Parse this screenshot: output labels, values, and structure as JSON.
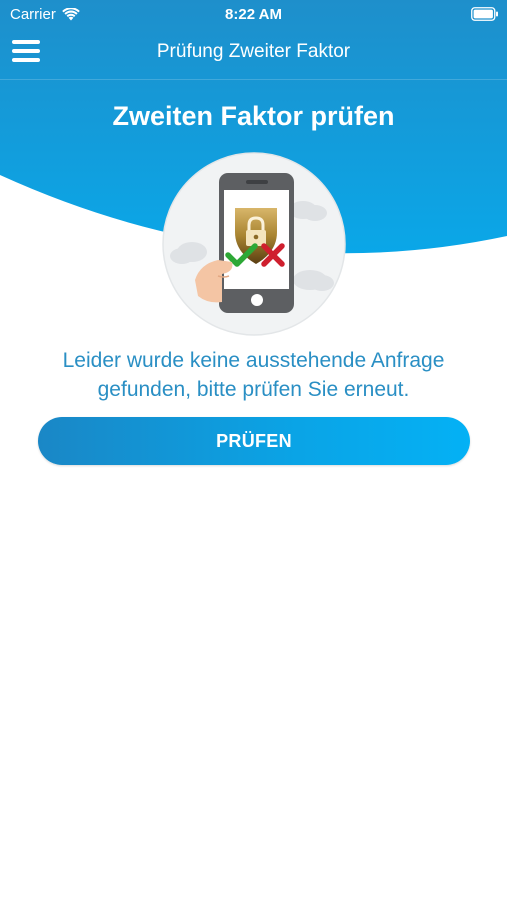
{
  "status_bar": {
    "carrier": "Carrier",
    "time": "8:22 AM"
  },
  "nav": {
    "title": "Prüfung Zweiter Faktor"
  },
  "main": {
    "heading": "Zweiten Faktor prüfen",
    "message_line1": "Leider wurde keine ausstehende Anfrage",
    "message_line2": "gefunden, bitte prüfen Sie erneut.",
    "check_button_label": "PRÜFEN"
  },
  "colors": {
    "header_top": "#1e8fcb",
    "header_bottom": "#0aa7e8",
    "message_text": "#2a8fc4",
    "button_start": "#1a87c6",
    "button_end": "#04b1f5"
  },
  "icons": {
    "menu": "hamburger-menu-icon",
    "wifi": "wifi-icon",
    "battery": "battery-icon",
    "illustration": "phone-shield-lock-icon"
  }
}
